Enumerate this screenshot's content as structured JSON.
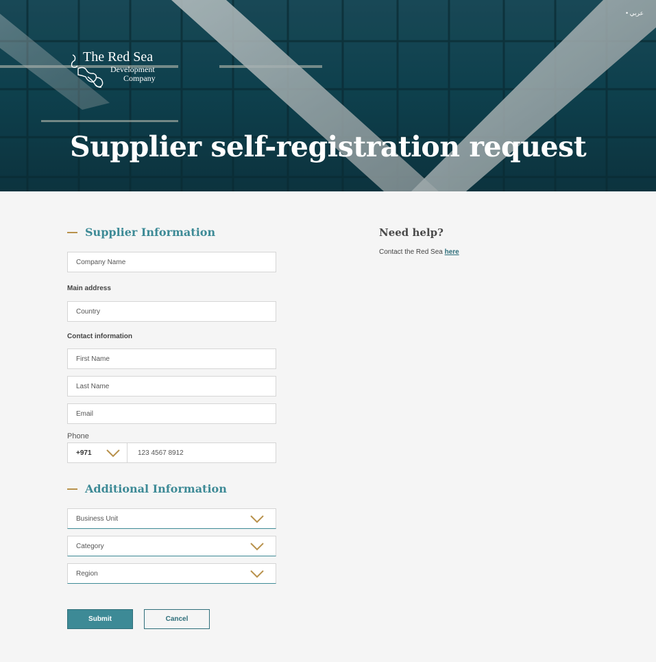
{
  "header": {
    "language_link": "• عربي",
    "logo": {
      "title": "The Red Sea",
      "subtitle_line1": "Development",
      "subtitle_line2": "Company"
    },
    "page_title": "Supplier self-registration request"
  },
  "supplier_section": {
    "title": "Supplier Information",
    "company_name_placeholder": "Company Name",
    "main_address_label": "Main address",
    "country_placeholder": "Country",
    "contact_info_label": "Contact information",
    "first_name_placeholder": "First Name",
    "last_name_placeholder": "Last Name",
    "email_placeholder": "Email",
    "phone_label": "Phone",
    "phone_code": "+971",
    "phone_placeholder": "123 4567 8912"
  },
  "additional_section": {
    "title": "Additional Information",
    "business_unit": "Business Unit",
    "category": "Category",
    "region": "Region"
  },
  "actions": {
    "submit": "Submit",
    "cancel": "Cancel"
  },
  "help": {
    "title": "Need help?",
    "text": "Contact the Red Sea ",
    "link": "here"
  },
  "colors": {
    "accent": "#3d8a96",
    "gold": "#b8914b",
    "background": "#f5f5f5"
  }
}
